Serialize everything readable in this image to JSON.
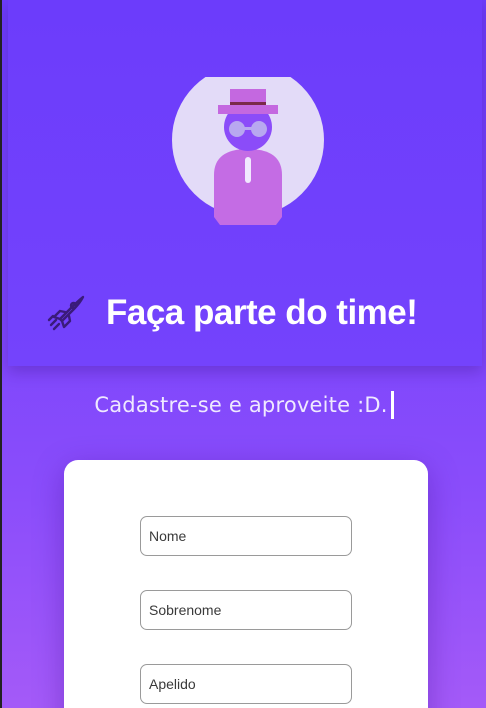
{
  "hero": {
    "title": "Faça parte do time!",
    "title_icon": "rocket-icon",
    "avatar_icon": "hat-spy-avatar-icon"
  },
  "subtitle": {
    "text": "Cadastre-se e aproveite :D."
  },
  "form": {
    "fields": [
      {
        "placeholder": "Nome"
      },
      {
        "placeholder": "Sobrenome"
      },
      {
        "placeholder": "Apelido"
      }
    ]
  },
  "colors": {
    "brand_purple": "#6d3dfb",
    "avatar_circle": "#e3dbf8",
    "avatar_body": "#c46ce4",
    "avatar_hat": "#c468e0",
    "avatar_head": "#8b4cf9",
    "icon_dark": "#3a1b7a"
  }
}
